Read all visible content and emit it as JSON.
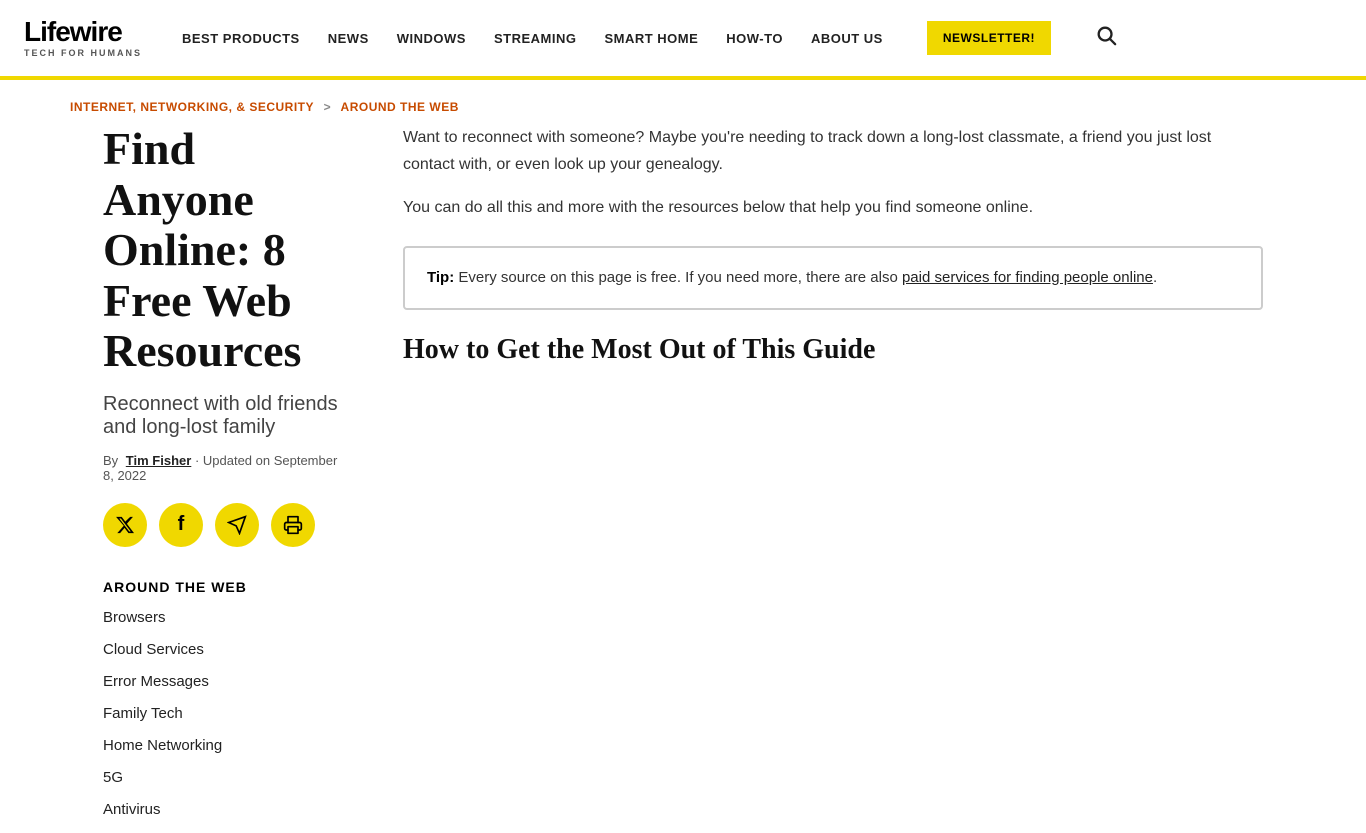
{
  "header": {
    "logo_text": "Lifewire",
    "logo_sub": "TECH FOR HUMANS",
    "nav": [
      {
        "label": "BEST PRODUCTS"
      },
      {
        "label": "NEWS"
      },
      {
        "label": "WINDOWS"
      },
      {
        "label": "STREAMING"
      },
      {
        "label": "SMART HOME"
      },
      {
        "label": "HOW-TO"
      },
      {
        "label": "ABOUT US"
      }
    ],
    "newsletter_btn": "NEWSLETTER!",
    "search_icon": "🔍"
  },
  "breadcrumb": {
    "parent": "INTERNET, NETWORKING, & SECURITY",
    "separator": ">",
    "current": "AROUND THE WEB"
  },
  "article": {
    "title": "Find Anyone Online: 8 Free Web Resources",
    "subtitle": "Reconnect with old friends and long-lost family",
    "meta_by": "By",
    "meta_author": "Tim Fisher",
    "meta_updated": "· Updated on September 8, 2022",
    "body_p1": "Want to reconnect with someone? Maybe you're needing to track down a long-lost classmate, a friend you just lost contact with, or even look up your genealogy.",
    "body_p2": "You can do all this and more with the resources below that help you find someone online.",
    "tip_label": "Tip:",
    "tip_text": "Every source on this page is free. If you need more, there are also",
    "tip_link": "paid services for finding people online",
    "tip_end": ".",
    "how_to_title": "How to Get the Most Out of This Guide"
  },
  "social": {
    "twitter": "𝕏",
    "facebook": "f",
    "telegram": "✈",
    "print": "🖨"
  },
  "sidebar": {
    "section_title": "AROUND THE WEB",
    "links": [
      {
        "label": "Browsers"
      },
      {
        "label": "Cloud Services"
      },
      {
        "label": "Error Messages"
      },
      {
        "label": "Family Tech"
      },
      {
        "label": "Home Networking"
      },
      {
        "label": "5G"
      },
      {
        "label": "Antivirus"
      }
    ]
  }
}
